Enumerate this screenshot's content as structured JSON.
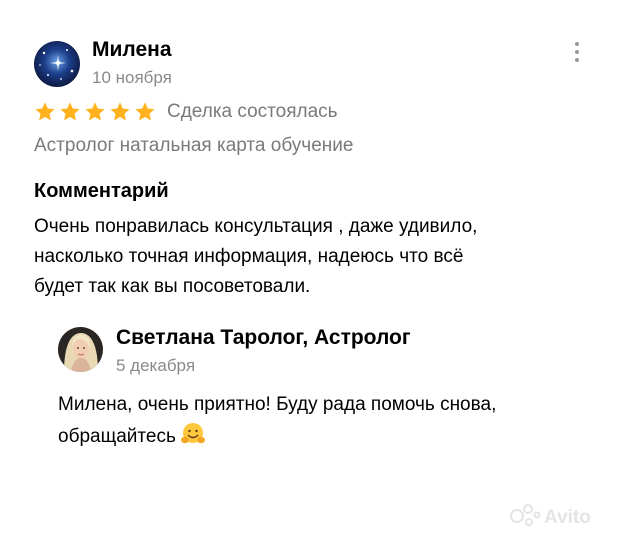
{
  "review": {
    "author": "Милена",
    "date": "10 ноября",
    "rating": 5,
    "rating_max": 5,
    "deal_status": "Сделка состоялась",
    "service": "Астролог натальная карта обучение",
    "comment_heading": "Комментарий",
    "comment_lines": [
      "Очень понравилась консультация , даже удивило,",
      "насколько точная информация, надеюсь что всё",
      "будет так как вы посоветовали."
    ]
  },
  "reply": {
    "author": "Светлана Таролог, Астролог",
    "date": "5 декабря",
    "text_lines": [
      "Милена, очень приятно! Буду рада помочь снова,",
      "обращайтесь"
    ],
    "emoji": "hugging-face"
  },
  "watermark": "Avito",
  "colors": {
    "star": "#ffb21e",
    "secondary_text": "#7a7a7a",
    "text": "#000000"
  }
}
